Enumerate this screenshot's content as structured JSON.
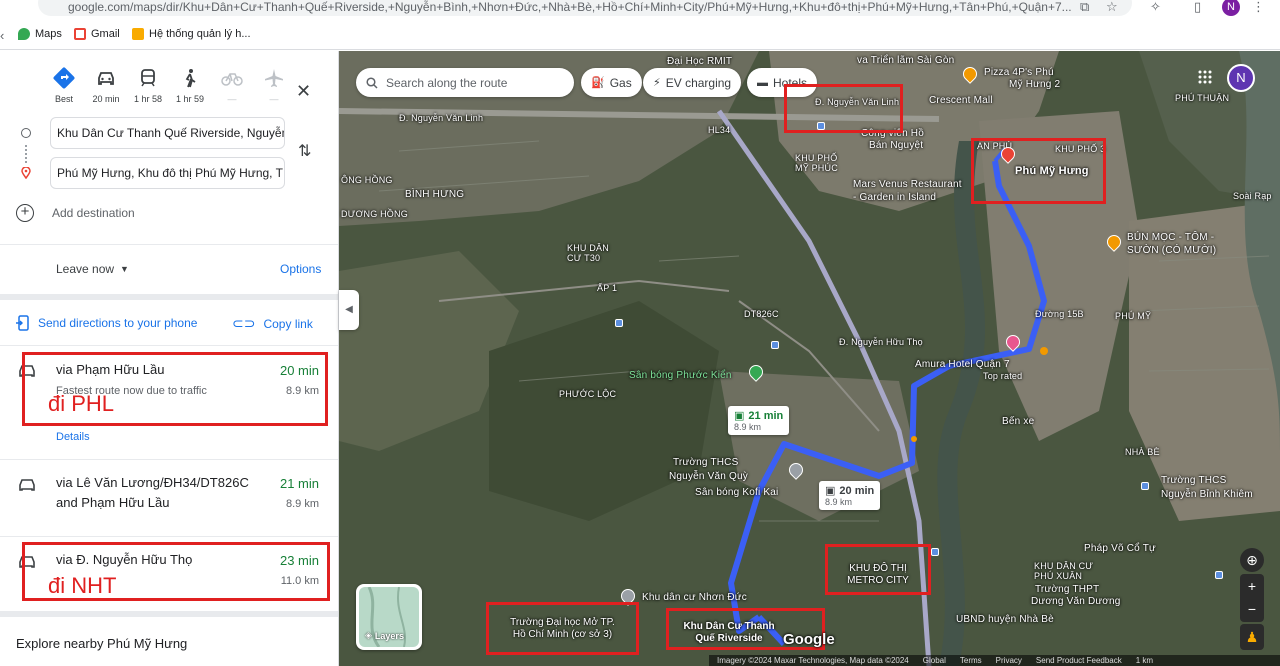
{
  "browser": {
    "url": "google.com/maps/dir/Khu+Dân+Cư+Thanh+Quế+Riverside,+Nguyễn+Bình,+Nhơn+Đức,+Nhà+Bè,+Hồ+Chí+Minh+City/Phú+Mỹ+Hưng,+Khu+đô+thị+Phú+Mỹ+Hưng,+Tân+Phú,+Quận+7...",
    "profile_initial": "N",
    "bookmarks": [
      {
        "label": "Maps",
        "color": "#34a853"
      },
      {
        "label": "Gmail",
        "color": "#ea4335"
      },
      {
        "label": "Hệ thống quản lý h...",
        "color": "#f9ab00"
      }
    ]
  },
  "travel_modes": [
    {
      "name": "Best",
      "enabled": true
    },
    {
      "name": "20 min",
      "enabled": true
    },
    {
      "name": "1 hr 58",
      "enabled": true
    },
    {
      "name": "1 hr 59",
      "enabled": true
    },
    {
      "name": "—",
      "enabled": false
    },
    {
      "name": "—",
      "enabled": false
    }
  ],
  "waypoints": {
    "origin": "Khu Dân Cư Thanh Quế Riverside, Nguyễn",
    "destination": "Phú Mỹ Hưng, Khu đô thị Phú Mỹ Hưng, T",
    "add_destination": "Add destination"
  },
  "leave": {
    "label": "Leave now",
    "options": "Options"
  },
  "share": {
    "send": "Send directions to your phone",
    "copy": "Copy link"
  },
  "routes": [
    {
      "name": "via Phạm Hữu Lầu",
      "time": "20 min",
      "distance": "8.9 km",
      "subtitle": "Fastest route now due to traffic",
      "details": "Details",
      "annotation": "đi PHL"
    },
    {
      "name": "via Lê Văn Lương/ĐH34/DT826C and Phạm Hữu Lầu",
      "time": "21 min",
      "distance": "8.9 km"
    },
    {
      "name": "via Đ. Nguyễn Hữu Thọ",
      "time": "23 min",
      "distance": "11.0 km",
      "annotation": "đi NHT"
    }
  ],
  "explore": "Explore nearby Phú Mỹ Hưng",
  "map": {
    "search_placeholder": "Search along the route",
    "chips": [
      "Gas",
      "EV charging",
      "Hotels"
    ],
    "user_initial": "N",
    "layers_label": "Layers",
    "google": "Google",
    "callouts": [
      {
        "time": "21 min",
        "distance": "8.9 km"
      },
      {
        "time": "20 min",
        "distance": "8.9 km"
      }
    ],
    "labels": {
      "trien_lam": "va Triển lãm Sài Gòn",
      "dai_hoc_rmit": "Đại Học RMIT",
      "pizza": "Pizza 4P's Phú",
      "pizza2": "Mỹ Hưng 2",
      "crescent": "Crescent Mall",
      "nguyen_van_linh": "Đ. Nguyễn Văn Linh",
      "nguyen_van_linh_road": "Đ. Nguyễn Văn Linh",
      "cong_vien": "Công viên Hồ",
      "ban_nguyet": "Bán Nguyệt",
      "khu_pho_my_phuc": "KHU PHỐ",
      "khu_pho_my_phuc2": "MỸ PHÚC",
      "mars_venus": "Mars Venus Restaurant",
      "mars_venus2": "- Garden in Island",
      "an_phu": "AN PHÚ",
      "khu_pho_3": "KHU PHỐ 3",
      "phu_my_hung": "Phú Mỹ Hưng",
      "phu_thuan": "PHÚ THUẬN",
      "ong_hong": "ÔNG HỒNG",
      "binh_hung": "BÌNH HƯNG",
      "duong_hong": "DƯƠNG HỒNG",
      "khu_dan_cu_t30": "KHU DÂN",
      "khu_dan_cu_t30b": "CƯ T30",
      "ap_1": "ẤP 1",
      "bun_moc": "BÚN MỌC - TÔM -",
      "bun_moc2": "SƯỜN (CÓ MƯỜI)",
      "duong_15b": "Đường 15B",
      "phu_my": "PHÚ MỸ",
      "amura": "Amura Hotel Quận 7",
      "amura2": "Top rated",
      "ben_xe": "Bến xe",
      "san_bong_phuoc_kien": "Sân bóng Phước Kiển",
      "phuoc_loc": "PHƯỚC LỘC",
      "dt826c": "DT826C",
      "nguyen_huu_tho": "Đ. Nguyễn Hữu Thọ",
      "thcs_nguyen_van_quy": "Trường THCS",
      "thcs_nguyen_van_quy2": "Nguyễn Văn Quỳ",
      "san_bong_kofi": "Sân bóng Kofi Kai",
      "khu_do_thi_metro": "KHU ĐÔ THỊ",
      "khu_do_thi_metro2": "METRO CITY",
      "khu_dan_cu_nhon_duc": "Khu dân cư Nhơn Đức",
      "dh_mo": "Trường Đại học Mở TP.",
      "dh_mo2": "Hồ Chí Minh (cơ sở 3)",
      "thanh_que": "Khu Dân Cư Thanh",
      "thanh_que2": "Quế Riverside",
      "nha_be": "NHÀ BÈ",
      "thcs_nguyen_binh_khiem": "Trường THCS",
      "thcs_nguyen_binh_khiem2": "Nguyễn Bỉnh Khiêm",
      "phap_vo": "Pháp Võ Cổ Tự",
      "khu_dan_cu_phu_xuan": "KHU DÂN CƯ",
      "khu_dan_cu_phu_xuan2": "PHÚ XUÂN",
      "thpt_duong_van_duong": "Trường THPT",
      "thpt_duong_van_duong2": "Dương Văn Dương",
      "ubnd": "UBND huyện Nhà Bè",
      "soai_rap": "Soài Rạp",
      "hl34": "HL34"
    },
    "attribution": [
      "Imagery ©2024 Maxar Technologies, Map data ©2024",
      "Global",
      "Terms",
      "Privacy",
      "Send Product Feedback",
      "1 km"
    ]
  }
}
